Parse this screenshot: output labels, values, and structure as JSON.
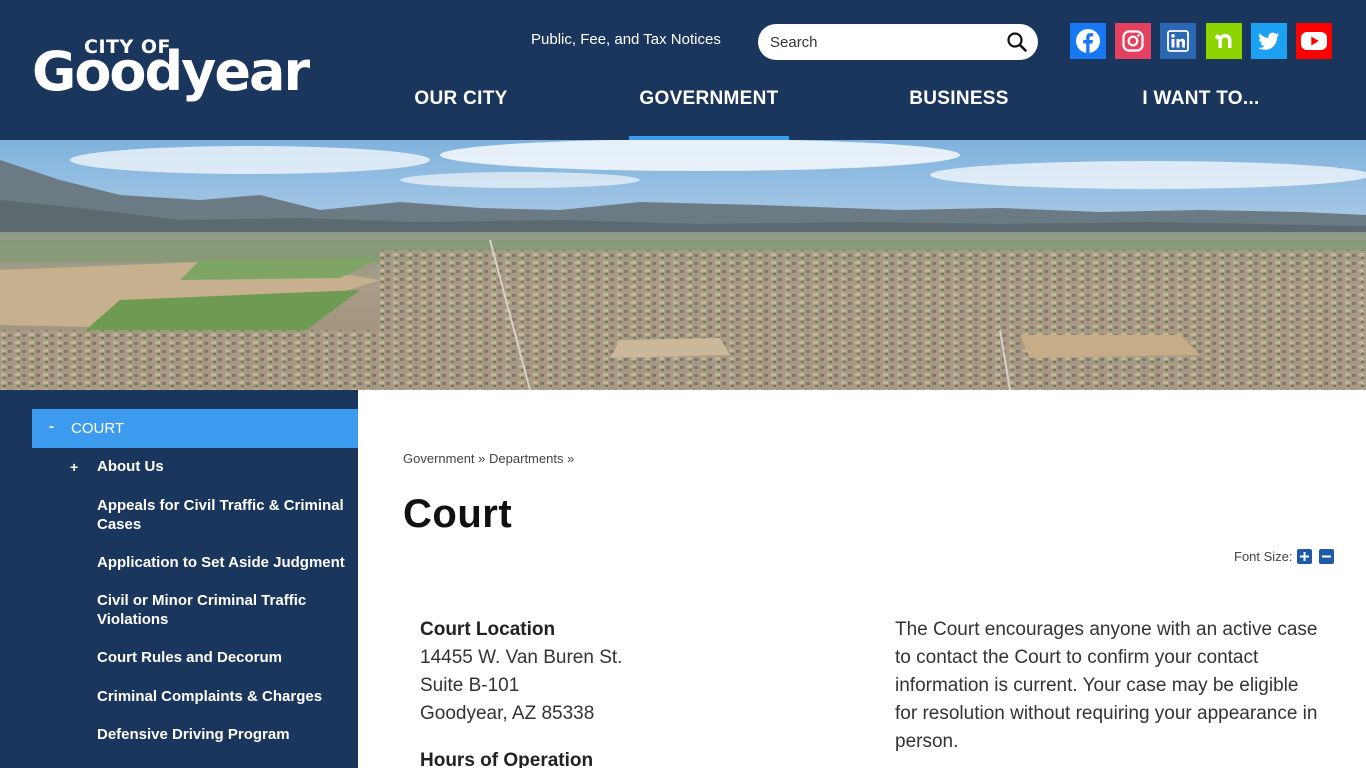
{
  "header": {
    "logo_top": "CITY OF",
    "logo_main": "Goodyear",
    "notices_link": "Public, Fee, and Tax Notices",
    "search_placeholder": "Search",
    "social": [
      {
        "name": "facebook-icon",
        "color": "#1877f2"
      },
      {
        "name": "instagram-icon",
        "color": "#e4405f"
      },
      {
        "name": "linkedin-icon",
        "color": "#2b67b3"
      },
      {
        "name": "nextdoor-icon",
        "color": "#8ed500"
      },
      {
        "name": "twitter-icon",
        "color": "#1da1f2"
      },
      {
        "name": "youtube-icon",
        "color": "#ff0000"
      }
    ],
    "nav": [
      "OUR CITY",
      "GOVERNMENT",
      "BUSINESS",
      "I WANT TO..."
    ],
    "active_nav": "GOVERNMENT"
  },
  "sidebar": {
    "section_toggle": "-",
    "section": "COURT",
    "expand_toggle": "+",
    "items": [
      "About Us",
      "Appeals for Civil Traffic & Criminal Cases",
      "Application to Set Aside Judgment",
      "Civil or Minor Criminal Traffic Violations",
      "Court Rules and Decorum",
      "Criminal Complaints & Charges",
      "Defensive Driving Program"
    ]
  },
  "main": {
    "breadcrumb": [
      "Government",
      "Departments"
    ],
    "breadcrumb_sep": "»",
    "title": "Court",
    "font_size_label": "Font Size:",
    "location_heading": "Court Location",
    "address": [
      "14455 W. Van Buren St.",
      "Suite B-101",
      "Goodyear, AZ 85338"
    ],
    "hours_heading": "Hours of Operation",
    "paragraph": "The Court encourages anyone with an active case to contact the Court to confirm your contact information is current. Your case may be eligible for resolution without requiring your appearance in person."
  },
  "colors": {
    "header_bg": "#1b365d",
    "accent": "#3d9bef"
  }
}
